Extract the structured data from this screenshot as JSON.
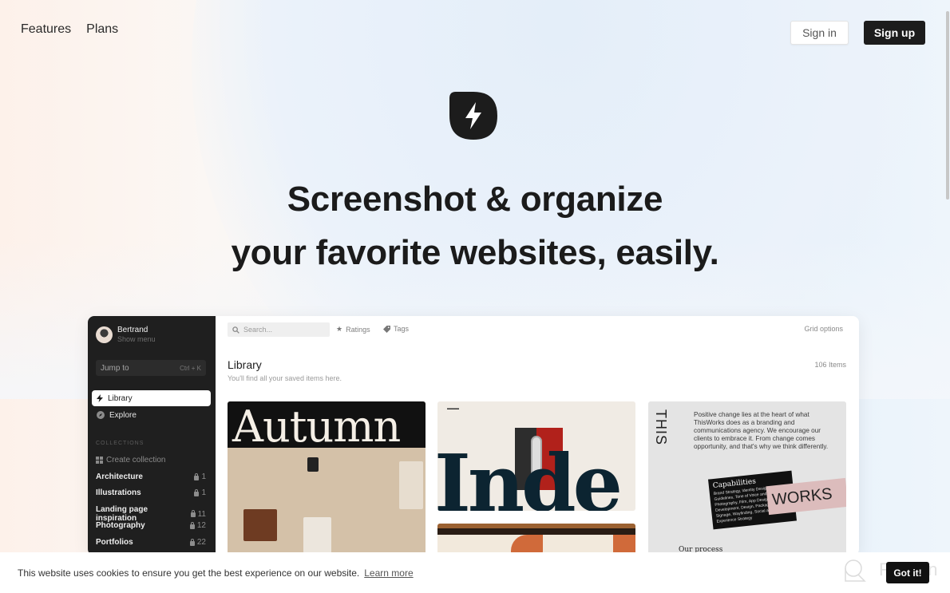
{
  "nav": {
    "items": [
      {
        "label": "Features"
      },
      {
        "label": "Plans"
      }
    ]
  },
  "auth": {
    "signin_label": "Sign in",
    "signup_label": "Sign up"
  },
  "hero": {
    "logo_icon": "lightning-bolt-icon",
    "headline_line1": "Screenshot & organize",
    "headline_line2": "your favorite websites, easily."
  },
  "app_preview": {
    "sidebar": {
      "user_name": "Bertrand",
      "user_menu": "Show menu",
      "jump_label": "Jump to",
      "jump_shortcut": "Ctrl + K",
      "nav_items": [
        {
          "label": "Library",
          "icon": "lightning-icon",
          "active": true
        },
        {
          "label": "Explore",
          "icon": "compass-icon",
          "active": false
        }
      ],
      "collections_header": "COLLECTIONS",
      "create_collection": "Create collection",
      "collections": [
        {
          "name": "Architecture",
          "count": "1"
        },
        {
          "name": "Illustrations",
          "count": "1"
        },
        {
          "name": "Landing page inspiration",
          "count": "11"
        },
        {
          "name": "Photography",
          "count": "12"
        },
        {
          "name": "Portfolios",
          "count": "22"
        }
      ]
    },
    "toolbar": {
      "search_placeholder": "Search...",
      "ratings_label": "Ratings",
      "tags_label": "Tags",
      "grid_options_label": "Grid options"
    },
    "library": {
      "title": "Library",
      "subtitle": "You'll find all your saved items here.",
      "count": "106 Items"
    },
    "cards": {
      "autumn_word": "Autumn",
      "inde_word": "Inde",
      "this_word": "THIS",
      "thisworks_paragraph": "Positive change lies at the heart of what ThisWorks does as a branding and communications agency. We encourage our clients to embrace it. From change comes opportunity, and that's why we think differently.",
      "capabilities_title": "Capabilities",
      "capabilities_text": "Brand Strategy, Identity Design, Guidelines, Tone of Voice and Direction, Photography, Film, App Design and Development, Design, Packaging, Signage, Wayfinding, Social and Experience Strategy",
      "works_word": "WORKS",
      "our_process": "Our process"
    }
  },
  "cookie": {
    "message": "This website uses cookies to ensure you get the best experience on our website.",
    "learn_more": "Learn more",
    "got_it": "Got it!"
  },
  "watermark": {
    "text": "Revain"
  }
}
